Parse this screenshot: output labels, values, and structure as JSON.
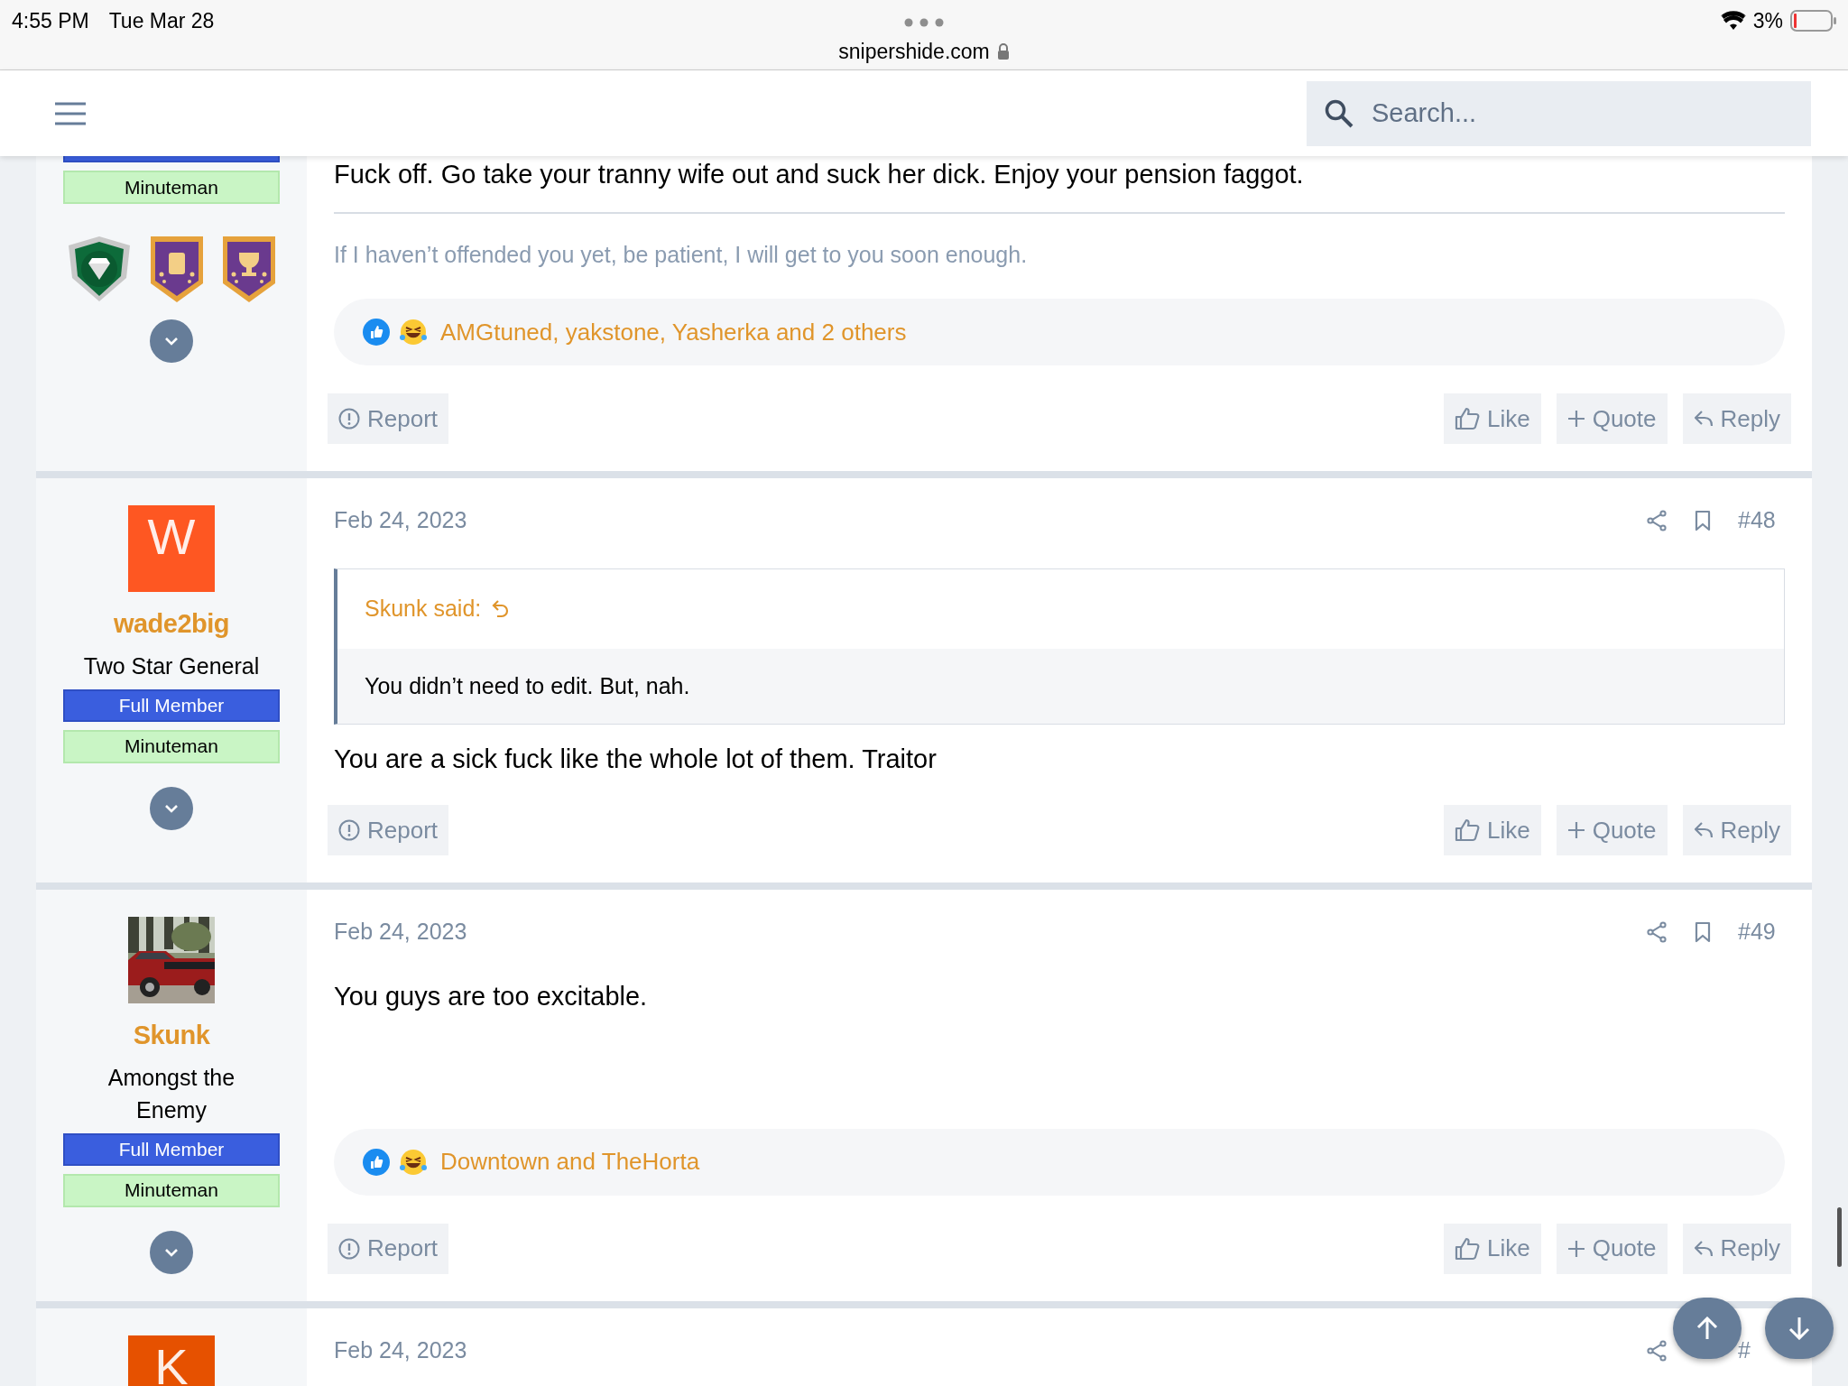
{
  "status_bar": {
    "time": "4:55 PM",
    "date": "Tue Mar 28",
    "url": "snipershide.com",
    "battery": "3%"
  },
  "header": {
    "search": {
      "placeholder": "Search..."
    }
  },
  "posts": [
    {
      "user": {
        "banners": [
          {
            "kind": "member_cut"
          },
          {
            "kind": "minuteman",
            "text": "Minuteman"
          }
        ],
        "trophies": true
      },
      "message": "Fuck off. Go take your tranny wife out and suck her dick. Enjoy your pension faggot.",
      "signature": "If I haven’t offended you yet, be patient, I will get to you soon enough.",
      "reactions": "AMGtuned, yakstone, Yasherka and 2 others",
      "actions": [
        {
          "kind": "report",
          "label": "Report"
        },
        {
          "kind": "like",
          "label": "Like"
        },
        {
          "kind": "quote",
          "label": "Quote"
        },
        {
          "kind": "reply",
          "label": "Reply"
        }
      ]
    },
    {
      "user": {
        "avatar": {
          "kind": "letter",
          "letter": "W",
          "color": "#fe5722"
        },
        "name": "wade2big",
        "title": "Two Star General",
        "banners": [
          {
            "kind": "member",
            "text": "Full Member"
          },
          {
            "kind": "minuteman",
            "text": "Minuteman"
          }
        ]
      },
      "date": "Feb 24, 2023",
      "header_icons": [
        {
          "kind": "share"
        },
        {
          "kind": "bookmark"
        }
      ],
      "number": "#48",
      "quote": {
        "author": "Skunk said:",
        "text": "You didn’t need to edit. But, nah."
      },
      "message": "You are a sick fuck like the whole lot of them. Traitor",
      "actions": [
        {
          "kind": "report",
          "label": "Report"
        },
        {
          "kind": "like",
          "label": "Like"
        },
        {
          "kind": "quote",
          "label": "Quote"
        },
        {
          "kind": "reply",
          "label": "Reply"
        }
      ]
    },
    {
      "user": {
        "name": "Skunk",
        "title": "Amongst the Enemy",
        "banners": [
          {
            "kind": "member",
            "text": "Full Member"
          },
          {
            "kind": "minuteman",
            "text": "Minuteman"
          }
        ]
      },
      "date": "Feb 24, 2023",
      "header_icons": [
        {
          "kind": "share"
        },
        {
          "kind": "bookmark"
        }
      ],
      "number": "#49",
      "message": "You guys are too excitable.",
      "reactions": "Downtown and TheHorta",
      "actions": [
        {
          "kind": "report",
          "label": "Report"
        },
        {
          "kind": "like",
          "label": "Like"
        },
        {
          "kind": "quote",
          "label": "Quote"
        },
        {
          "kind": "reply",
          "label": "Reply"
        }
      ]
    },
    {
      "user": {
        "avatar": {
          "kind": "letter",
          "letter": "K",
          "color": "#e65100"
        }
      },
      "date": "Feb 24, 2023",
      "header_icons": [
        {
          "kind": "share"
        }
      ],
      "number": "#"
    }
  ]
}
